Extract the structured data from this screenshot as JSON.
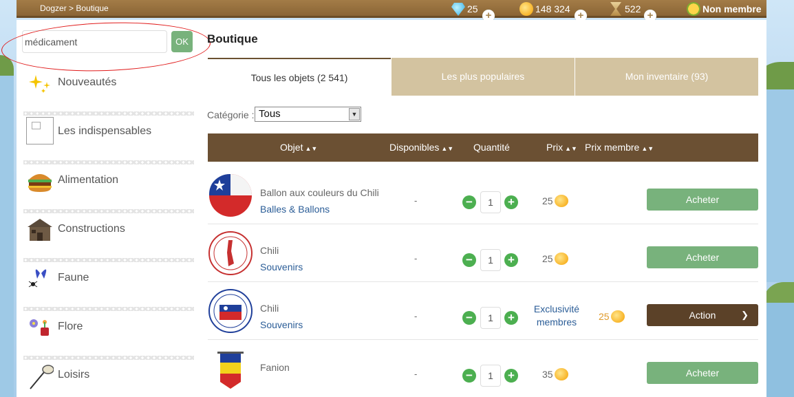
{
  "topbar": {
    "breadcrumb": "Dogzer > Boutique",
    "diamonds": "25",
    "coins": "148 324",
    "hourglass": "522",
    "membership": "Non membre",
    "plus_symbol": "+"
  },
  "sidebar": {
    "search_value": "médicament",
    "ok_label": "OK",
    "items": [
      {
        "label": "Nouveautés",
        "icon": "sparkles-icon"
      },
      {
        "label": "Les indispensables",
        "icon": "broken-image-icon"
      },
      {
        "label": "Alimentation",
        "icon": "burger-icon"
      },
      {
        "label": "Constructions",
        "icon": "cabin-icon"
      },
      {
        "label": "Faune",
        "icon": "butterfly-icon"
      },
      {
        "label": "Flore",
        "icon": "flower-icon"
      },
      {
        "label": "Loisirs",
        "icon": "net-icon"
      }
    ]
  },
  "main": {
    "title": "Boutique",
    "tabs": [
      {
        "label": "Tous les objets (2 541)",
        "active": true
      },
      {
        "label": "Les plus populaires",
        "active": false
      },
      {
        "label": "Mon inventaire (93)",
        "active": false
      }
    ],
    "category_label": "Catégorie :",
    "category_value": "Tous",
    "table_headers": {
      "objet": "Objet",
      "disponibles": "Disponibles",
      "quantite": "Quantité",
      "prix": "Prix",
      "prix_membre": "Prix membre"
    },
    "rows": [
      {
        "name": "Ballon aux couleurs du Chili",
        "category": "Balles & Ballons",
        "dispo": "-",
        "qty": "1",
        "price": "25",
        "action": "Acheter"
      },
      {
        "name": "Chili",
        "category": "Souvenirs",
        "dispo": "-",
        "qty": "1",
        "price": "25",
        "action": "Acheter"
      },
      {
        "name": "Chili",
        "category": "Souvenirs",
        "dispo": "-",
        "qty": "1",
        "price": "Exclusivité membres",
        "member_price": "25",
        "action": "Action"
      },
      {
        "name": "Fanion",
        "category": "",
        "dispo": "-",
        "qty": "1",
        "price": "35",
        "action": "Acheter"
      }
    ],
    "minus_symbol": "−",
    "plus_symbol": "+"
  },
  "colors": {
    "topbar": "#8a6435",
    "table_header": "#6b5033",
    "buy_button": "#78b27c",
    "action_button": "#5b4128",
    "tab_inactive": "#d3c3a0",
    "link": "#2b5d97",
    "annotation_red": "#e01818"
  }
}
